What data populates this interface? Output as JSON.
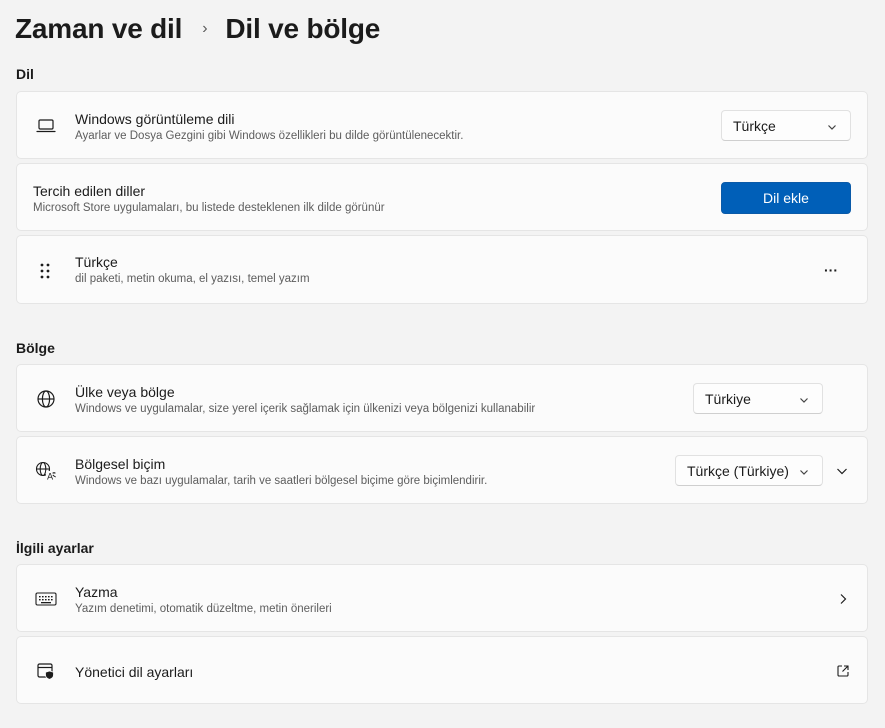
{
  "breadcrumb": {
    "parent": "Zaman ve dil",
    "separator": "›",
    "current": "Dil ve bölge"
  },
  "sections": {
    "language": "Dil",
    "region": "Bölge",
    "related": "İlgili ayarlar"
  },
  "display_language": {
    "title": "Windows görüntüleme dili",
    "subtitle": "Ayarlar ve Dosya Gezgini gibi Windows özellikleri bu dilde görüntülenecektir.",
    "value": "Türkçe",
    "icon": "laptop-icon"
  },
  "preferred_languages": {
    "title": "Tercih edilen diller",
    "subtitle": "Microsoft Store uygulamaları, bu listede desteklenen ilk dilde görünür",
    "button": "Dil ekle"
  },
  "language_item": {
    "title": "Türkçe",
    "subtitle": "dil paketi, metin okuma, el yazısı, temel yazım",
    "menu": "···",
    "icon": "drag-handle-icon"
  },
  "country": {
    "title": "Ülke veya bölge",
    "subtitle": "Windows ve uygulamalar, size yerel içerik sağlamak için ülkenizi veya bölgenizi kullanabilir",
    "value": "Türkiye",
    "icon": "globe-icon"
  },
  "regional_format": {
    "title": "Bölgesel biçim",
    "subtitle": "Windows ve bazı uygulamalar, tarih ve saatleri bölgesel biçime göre biçimlendirir.",
    "value": "Türkçe (Türkiye)",
    "icon": "regional-format-icon"
  },
  "typing": {
    "title": "Yazma",
    "subtitle": "Yazım denetimi, otomatik düzeltme, metin önerileri",
    "icon": "keyboard-icon"
  },
  "admin_language": {
    "title": "Yönetici dil ayarları",
    "icon": "admin-shield-icon"
  },
  "colors": {
    "accent": "#005fb8",
    "background": "#f3f3f3",
    "card": "#fbfbfb"
  }
}
